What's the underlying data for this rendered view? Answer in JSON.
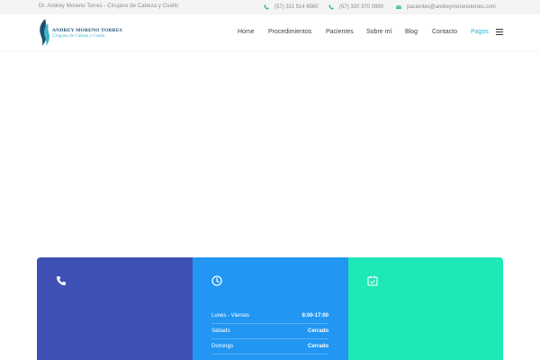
{
  "topbar": {
    "tagline": "Dr. Andrey Moreno Torres - Cirujano de Cabeza y Cuello",
    "phone1": "(57) 311 514 6560",
    "phone2": "(57) 320 370 0990",
    "email": "pacientes@andreymorenotorres.com",
    "phone_icon": "phone-icon",
    "mail_icon": "envelope-icon"
  },
  "logo": {
    "name": "ANDREY MORENO TORRES",
    "subtitle": "Cirujano de Cabeza y Cuello"
  },
  "nav": {
    "items": [
      {
        "label": "Home"
      },
      {
        "label": "Procedimientos"
      },
      {
        "label": "Pacientes"
      },
      {
        "label": "Sobre mí"
      },
      {
        "label": "Blog"
      },
      {
        "label": "Contacto"
      },
      {
        "label": "Pagos"
      }
    ],
    "active": "Pagos",
    "menu_icon": "hamburger-icon"
  },
  "colors": {
    "accent": "#26b8d6",
    "panel_phone": "#3f51b5",
    "panel_hours": "#2196f3",
    "panel_schedule": "#1de9b6"
  },
  "panels": {
    "phone": {
      "icon": "phone-icon"
    },
    "hours": {
      "icon": "clock-icon",
      "rows": [
        {
          "day": "Lunes - Viernes",
          "time": "8:00-17:00"
        },
        {
          "day": "Sábado",
          "time": "Cerrado"
        },
        {
          "day": "Domingo",
          "time": "Cerrado"
        }
      ]
    },
    "appointment": {
      "icon": "calendar-check-icon"
    }
  }
}
